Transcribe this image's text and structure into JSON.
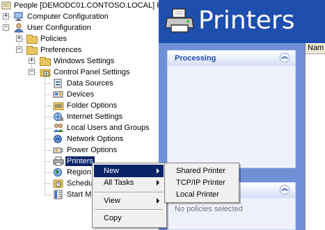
{
  "tree": {
    "root": "People [DEMODC01.CONTOSO.LOCAL] Po",
    "computer_config": "Computer Configuration",
    "user_config": "User Configuration",
    "policies": "Policies",
    "preferences": "Preferences",
    "windows_settings": "Windows Settings",
    "control_panel_settings": "Control Panel Settings",
    "items": [
      "Data Sources",
      "Devices",
      "Folder Options",
      "Internet Settings",
      "Local Users and Groups",
      "Network Options",
      "Power Options",
      "Printers",
      "Region",
      "Schedu",
      "Start M"
    ]
  },
  "header": {
    "title": "Printers"
  },
  "panels": {
    "processing_title": "Processing",
    "second_empty_text": "No policies selected"
  },
  "list": {
    "column": "Nam"
  },
  "context_menu": {
    "new": "New",
    "all_tasks": "All Tasks",
    "view": "View",
    "copy": "Copy"
  },
  "submenu": {
    "shared_printer": "Shared Printer",
    "tcpip_printer": "TCP/IP Printer",
    "local_printer": "Local Printer"
  },
  "colors": {
    "header_blue": "#1f4fae",
    "body_blue": "#6f8fd6",
    "selection": "#0a246a"
  }
}
